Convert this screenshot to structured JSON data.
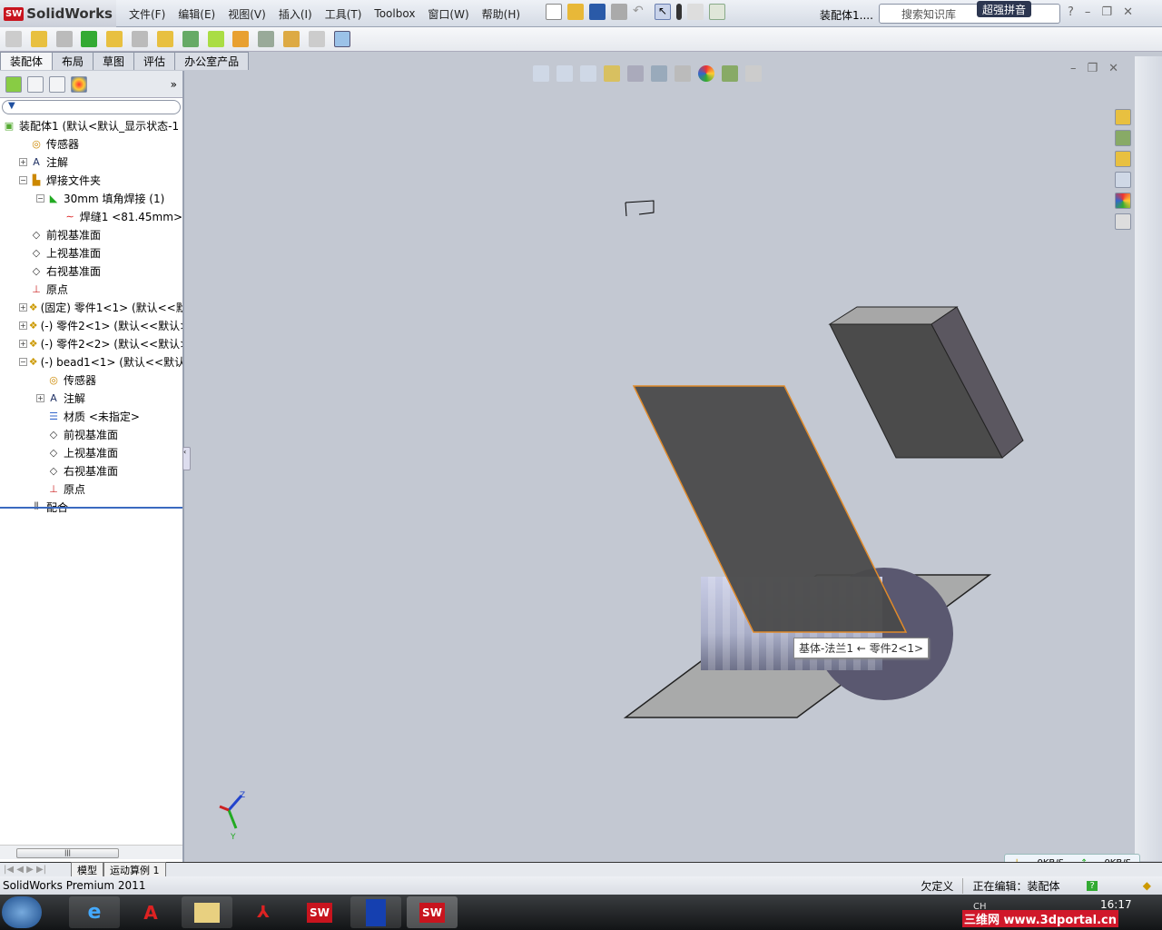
{
  "app": {
    "brand": "SolidWorks",
    "doc_title": "装配体1....",
    "search_placeholder": "搜索知识库",
    "ime": "超强拼音"
  },
  "menu": [
    "文件(F)",
    "编辑(E)",
    "视图(V)",
    "插入(I)",
    "工具(T)",
    "Toolbox",
    "窗口(W)",
    "帮助(H)"
  ],
  "tabs": [
    "装配体",
    "布局",
    "草图",
    "评估",
    "办公室产品"
  ],
  "tree": [
    {
      "label": "装配体1 (默认<默认_显示状态-1",
      "icon": "assembly-icon",
      "children": [
        {
          "label": "传感器",
          "icon": "sensor-icon"
        },
        {
          "label": "注解",
          "icon": "annotation-icon",
          "collapsed": true
        },
        {
          "label": "焊接文件夹",
          "icon": "weld-folder-icon",
          "expanded": true,
          "children": [
            {
              "label": "30mm 填角焊接 (1)",
              "icon": "fillet-weld-icon",
              "expanded": true,
              "children": [
                {
                  "label": "焊缝1 <81.45mm>",
                  "icon": "weld-bead-icon"
                }
              ]
            }
          ]
        },
        {
          "label": "前视基准面",
          "icon": "plane-icon"
        },
        {
          "label": "上视基准面",
          "icon": "plane-icon"
        },
        {
          "label": "右视基准面",
          "icon": "plane-icon"
        },
        {
          "label": "原点",
          "icon": "origin-icon"
        },
        {
          "label": "(固定) 零件1<1> (默认<<默认",
          "icon": "part-icon",
          "collapsed": true
        },
        {
          "label": "(-) 零件2<1> (默认<<默认>_",
          "icon": "part-icon",
          "collapsed": true
        },
        {
          "label": "(-) 零件2<2> (默认<<默认>_",
          "icon": "part-icon",
          "collapsed": true
        },
        {
          "label": "(-) bead1<1> (默认<<默认>",
          "icon": "part-icon",
          "expanded": true,
          "children": [
            {
              "label": "传感器",
              "icon": "sensor-icon"
            },
            {
              "label": "注解",
              "icon": "annotation-icon",
              "collapsed": true
            },
            {
              "label": "材质 <未指定>",
              "icon": "material-icon"
            },
            {
              "label": "前视基准面",
              "icon": "plane-icon"
            },
            {
              "label": "上视基准面",
              "icon": "plane-icon"
            },
            {
              "label": "右视基准面",
              "icon": "plane-icon"
            },
            {
              "label": "原点",
              "icon": "origin-icon"
            }
          ]
        },
        {
          "label": "配合",
          "icon": "mates-icon"
        }
      ]
    }
  ],
  "viewport": {
    "tooltip": "基体-法兰1 ← 零件2<1>",
    "triad": {
      "z": "Z",
      "y": "Y"
    }
  },
  "bottom_tabs": [
    "模型",
    "运动算例 1"
  ],
  "net": {
    "down": "0KB/S",
    "up": "0KB/S"
  },
  "status": {
    "product": "SolidWorks Premium 2011",
    "state": "欠定义",
    "editing": "正在编辑：装配体"
  },
  "taskbar": {
    "time": "16:17",
    "ime": "CH",
    "watermark": "三维网 www.3dportal.cn",
    "apps": [
      "start-button",
      "internet-explorer",
      "autocad",
      "file-explorer",
      "adobe-reader",
      "solidworks",
      "toolbox-app",
      "solidworks-active"
    ]
  },
  "colors": {
    "accent": "#c8141e",
    "selection": "#e08a2a",
    "viewport_bg": "#c3c8d2"
  }
}
